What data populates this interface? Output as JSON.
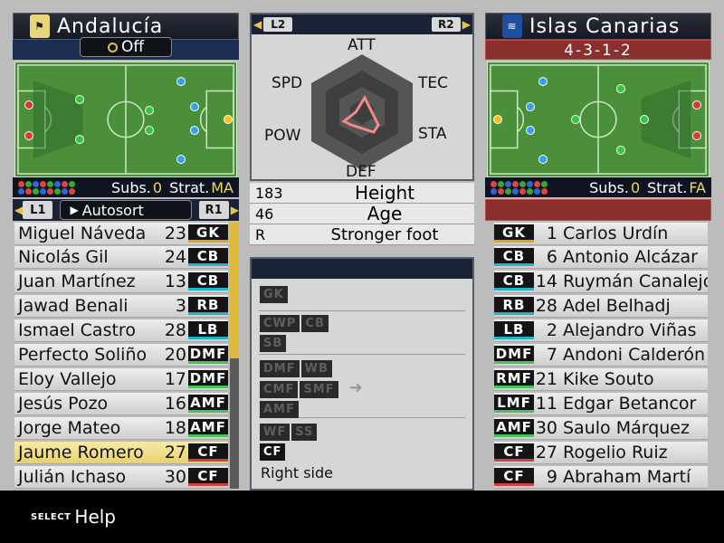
{
  "left_team": {
    "name": "Andalucía",
    "toggle": "Off",
    "subs_label": "Subs.",
    "subs_value": "0",
    "strat_label": "Strat.",
    "strat_value": "MA",
    "l_button": "L1",
    "r_button": "R1",
    "sort_label": "Autosort",
    "players": [
      {
        "name": "Miguel Náveda",
        "num": "23",
        "pos": "GK"
      },
      {
        "name": "Nicolás Gil",
        "num": "24",
        "pos": "CB"
      },
      {
        "name": "Juan Martínez",
        "num": "13",
        "pos": "CB"
      },
      {
        "name": "Jawad Benali",
        "num": "3",
        "pos": "RB"
      },
      {
        "name": "Ismael Castro",
        "num": "28",
        "pos": "LB"
      },
      {
        "name": "Perfecto Soliño",
        "num": "20",
        "pos": "DMF"
      },
      {
        "name": "Eloy Vallejo",
        "num": "17",
        "pos": "DMF"
      },
      {
        "name": "Jesús Pozo",
        "num": "16",
        "pos": "AMF"
      },
      {
        "name": "Jorge Mateo",
        "num": "18",
        "pos": "AMF"
      },
      {
        "name": "Jaume Romero",
        "num": "27",
        "pos": "CF"
      },
      {
        "name": "Julián Ichaso",
        "num": "30",
        "pos": "CF"
      }
    ]
  },
  "right_team": {
    "name": "Islas Canarias",
    "formation": "4-3-1-2",
    "subs_label": "Subs.",
    "subs_value": "0",
    "strat_label": "Strat.",
    "strat_value": "FA",
    "players": [
      {
        "name": "Carlos Urdín",
        "num": "1",
        "pos": "GK"
      },
      {
        "name": "Antonio Alcázar",
        "num": "6",
        "pos": "CB"
      },
      {
        "name": "Ruymán Canalejo",
        "num": "14",
        "pos": "CB"
      },
      {
        "name": "Adel Belhadj",
        "num": "28",
        "pos": "RB"
      },
      {
        "name": "Alejandro Viñas",
        "num": "2",
        "pos": "LB"
      },
      {
        "name": "Andoni Calderón",
        "num": "7",
        "pos": "DMF"
      },
      {
        "name": "Kike Souto",
        "num": "21",
        "pos": "RMF"
      },
      {
        "name": "Edgar Betancor",
        "num": "11",
        "pos": "LMF"
      },
      {
        "name": "Saulo Márquez",
        "num": "30",
        "pos": "AMF"
      },
      {
        "name": "Rogelio Ruiz",
        "num": "27",
        "pos": "CF"
      },
      {
        "name": "Abraham Martí",
        "num": "9",
        "pos": "CF"
      }
    ]
  },
  "center": {
    "l_button": "L2",
    "r_button": "R2",
    "radar_labels": {
      "att": "ATT",
      "tec": "TEC",
      "sta": "STA",
      "def": "DEF",
      "pow": "POW",
      "spd": "SPD"
    },
    "height_value": "183",
    "height_label": "Height",
    "age_value": "46",
    "age_label": "Age",
    "foot_value": "R",
    "foot_label": "Stronger foot",
    "position_groups": [
      [
        "GK"
      ],
      [
        "CWP",
        "CB",
        "SB"
      ],
      [
        "DMF",
        "WB",
        "CMF",
        "SMF",
        "AMF"
      ],
      [
        "WF",
        "SS",
        "CF"
      ]
    ],
    "side_label": "Right side"
  },
  "help": {
    "key": "SELECT",
    "label": "Help"
  }
}
